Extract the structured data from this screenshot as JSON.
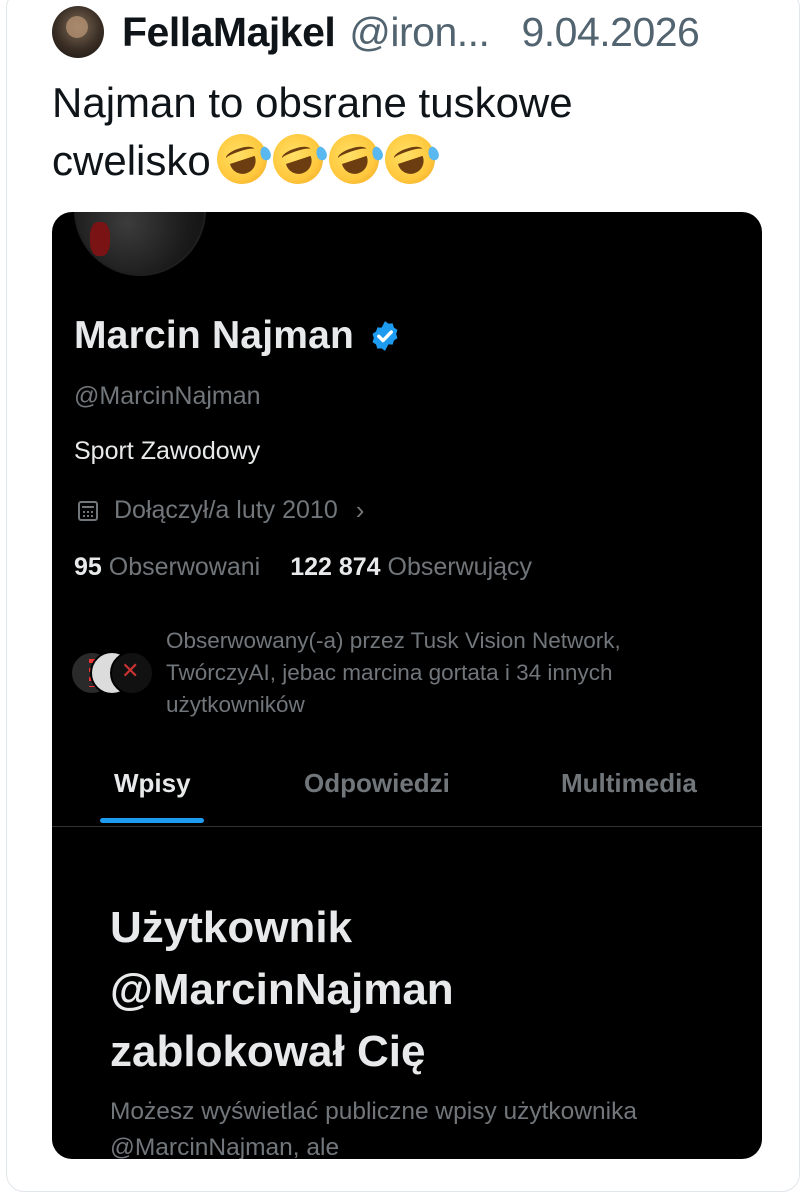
{
  "tweet": {
    "author_name": "FellaMajkel",
    "author_handle": "@iron...",
    "date": "9.04.2026",
    "text_line1": "Najman to obsrane tuskowe",
    "text_line2": "cwelisko",
    "emoji_name": "rolling-on-the-floor-laughing-emoji",
    "emoji_count": 4
  },
  "profile": {
    "name": "Marcin Najman",
    "verified_color": "#1d9bf0",
    "handle": "@MarcinNajman",
    "bio": "Sport Zawodowy",
    "joined": "Dołączył/a luty 2010",
    "following_count": "95",
    "following_label": "Obserwowani",
    "followers_count": "122 874",
    "followers_label": "Obserwujący",
    "followed_by": "Obserwowany(-a) przez Tusk Vision Network, TwórczyAI, jebac marcina gortata i 34 innych użytkowników"
  },
  "tabs": [
    {
      "label": "Wpisy",
      "active": true
    },
    {
      "label": "Odpowiedzi",
      "active": false
    },
    {
      "label": "Multimedia",
      "active": false
    }
  ],
  "blocked": {
    "line1": "Użytkownik",
    "line2": "@MarcinNajman",
    "line3": "zablokował Cię",
    "subtitle": "Możesz wyświetlać publiczne wpisy użytkownika @MarcinNajman, ale"
  },
  "colors": {
    "accent": "#1d9bf0",
    "dark_bg": "#000000",
    "muted_text": "#71767b"
  }
}
